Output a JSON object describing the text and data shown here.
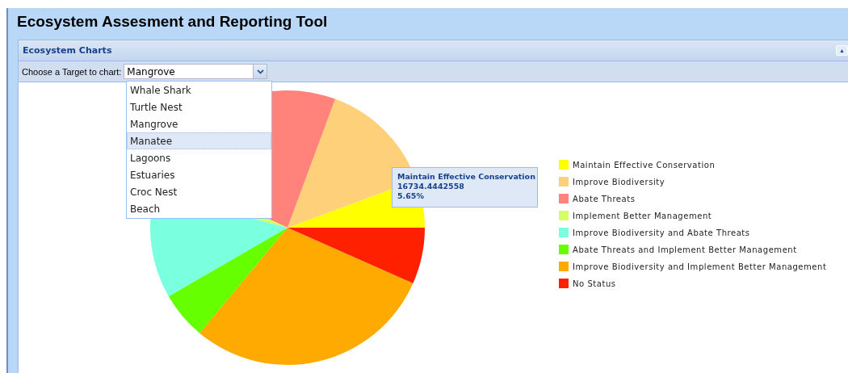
{
  "app": {
    "title": "Ecosystem Assesment and Reporting Tool"
  },
  "panel": {
    "title": "Ecosystem Charts",
    "collapse_icon": "▲"
  },
  "target": {
    "label": "Choose a Target to chart:",
    "value": "Mangrove",
    "expanded": true,
    "options": [
      {
        "label": "Whale Shark",
        "highlighted": false
      },
      {
        "label": "Turtle Nest",
        "highlighted": false
      },
      {
        "label": "Mangrove",
        "highlighted": false
      },
      {
        "label": "Manatee",
        "highlighted": true
      },
      {
        "label": "Lagoons",
        "highlighted": false
      },
      {
        "label": "Estuaries",
        "highlighted": false
      },
      {
        "label": "Croc Nest",
        "highlighted": false
      },
      {
        "label": "Beach",
        "highlighted": false
      }
    ]
  },
  "tooltip": {
    "title": "Maintain Effective Conservation",
    "value": "16734.4442558",
    "percent": "5.65%"
  },
  "legend": [
    {
      "label": "Maintain Effective Conservation",
      "color": "#ffff00"
    },
    {
      "label": "Improve Biodiversity",
      "color": "#ffd07a"
    },
    {
      "label": "Abate Threats",
      "color": "#ff837a"
    },
    {
      "label": "Implement Better Management",
      "color": "#d4ff66"
    },
    {
      "label": "Improve Biodiversity and Abate Threats",
      "color": "#7affdf"
    },
    {
      "label": "Abate Threats and Implement Better Management",
      "color": "#66ff00"
    },
    {
      "label": "Improve Biodiversity and Implement Better Management",
      "color": "#ffaa00"
    },
    {
      "label": "No Status",
      "color": "#ff2000"
    }
  ]
}
